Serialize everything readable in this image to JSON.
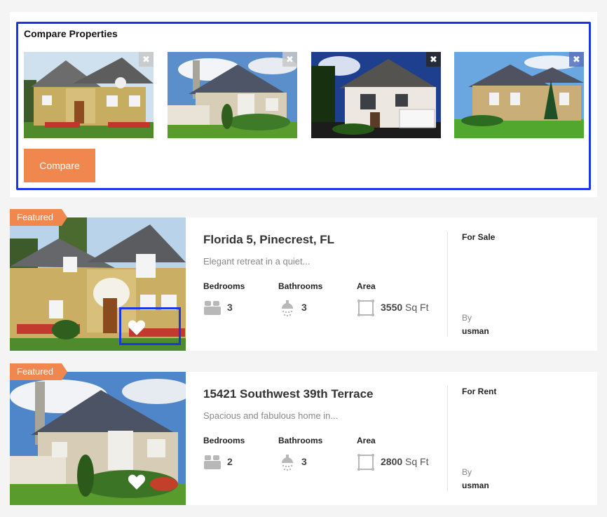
{
  "compare": {
    "title": "Compare Properties",
    "close_glyph": "✖",
    "button_label": "Compare",
    "thumbnails": [
      {
        "alt": "house-1"
      },
      {
        "alt": "house-2"
      },
      {
        "alt": "house-3"
      },
      {
        "alt": "house-4"
      }
    ]
  },
  "listings": [
    {
      "badge": "Featured",
      "title": "Florida 5, Pinecrest, FL",
      "description": "Elegant retreat in a quiet...",
      "bedrooms_label": "Bedrooms",
      "bedrooms": "3",
      "bathrooms_label": "Bathrooms",
      "bathrooms": "3",
      "area_label": "Area",
      "area": "3550",
      "area_unit": "Sq Ft",
      "status": "For Sale",
      "by_label": "By",
      "agent": "usman"
    },
    {
      "badge": "Featured",
      "title": "15421 Southwest 39th Terrace",
      "description": "Spacious and fabulous home in...",
      "bedrooms_label": "Bedrooms",
      "bedrooms": "2",
      "bathrooms_label": "Bathrooms",
      "bathrooms": "3",
      "area_label": "Area",
      "area": "2800",
      "area_unit": "Sq Ft",
      "status": "For Rent",
      "by_label": "By",
      "agent": "usman"
    }
  ],
  "icons": {
    "close": "close-icon",
    "heart": "heart-icon",
    "bed": "bed-icon",
    "bath": "shower-icon",
    "area": "area-icon"
  },
  "colors": {
    "accent": "#f0874f",
    "focus_outline": "#1b36e6"
  }
}
